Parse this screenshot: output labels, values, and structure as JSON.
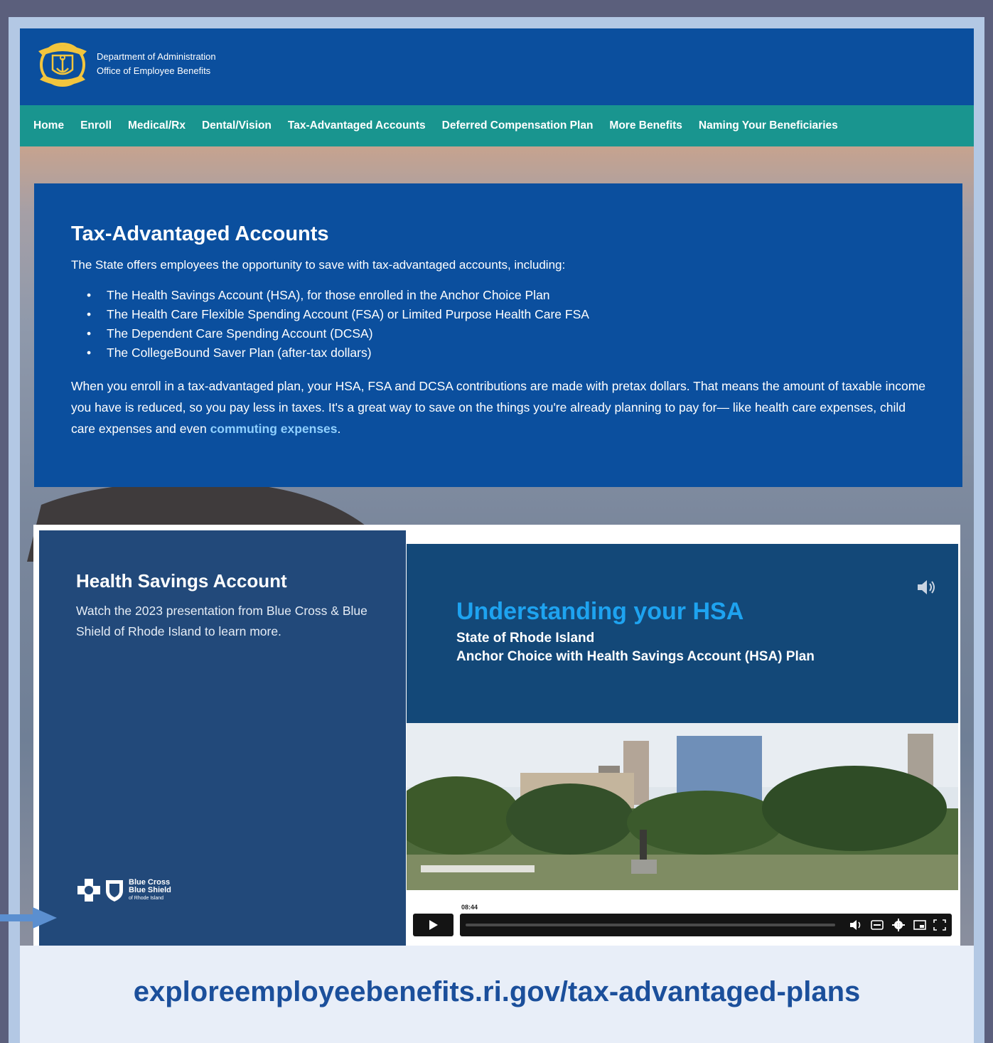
{
  "header": {
    "line1": "Department of Administration",
    "line2": "Office of Employee Benefits"
  },
  "nav": [
    "Home",
    "Enroll",
    "Medical/Rx",
    "Dental/Vision",
    "Tax-Advantaged Accounts",
    "Deferred Compensation Plan",
    "More Benefits",
    "Naming Your Beneficiaries"
  ],
  "tax": {
    "title": "Tax-Advantaged Accounts",
    "intro": "The State offers employees the opportunity to save with tax-advantaged accounts, including:",
    "items": [
      "The Health Savings Account (HSA), for those enrolled in the Anchor Choice Plan",
      "The Health Care Flexible Spending Account (FSA) or Limited Purpose Health Care FSA",
      "The Dependent Care Spending Account (DCSA)",
      "The CollegeBound Saver Plan (after-tax dollars)"
    ],
    "body": "When you enroll in a tax-advantaged plan, your HSA, FSA and DCSA contributions are made with pretax dollars. That means the amount of taxable income you have is reduced, so you pay less in taxes. It's a great way to save on the things you're already planning to pay for— like health care expenses, child care expenses and even",
    "link": "commuting expenses",
    "end": "."
  },
  "hsa": {
    "title": "Health Savings Account",
    "desc": "Watch the 2023 presentation from Blue Cross & Blue Shield of Rhode Island to learn more.",
    "logo_line1": "Blue Cross",
    "logo_line2": "Blue Shield",
    "logo_line3": "of Rhode Island"
  },
  "video": {
    "title": "Understanding your HSA",
    "sub1": "State of Rhode Island",
    "sub2": "Anchor Choice with Health Savings Account (HSA) Plan",
    "time": "08:44",
    "progress": 0
  },
  "url": "exploreemployeebenefits.ri.gov/tax-advantaged-plans",
  "colors": {
    "header": "#0b4f9e",
    "nav": "#19958f",
    "hsa_panel": "#22497a",
    "video_title": "#1ea3f0",
    "url": "#1b4f9b"
  }
}
